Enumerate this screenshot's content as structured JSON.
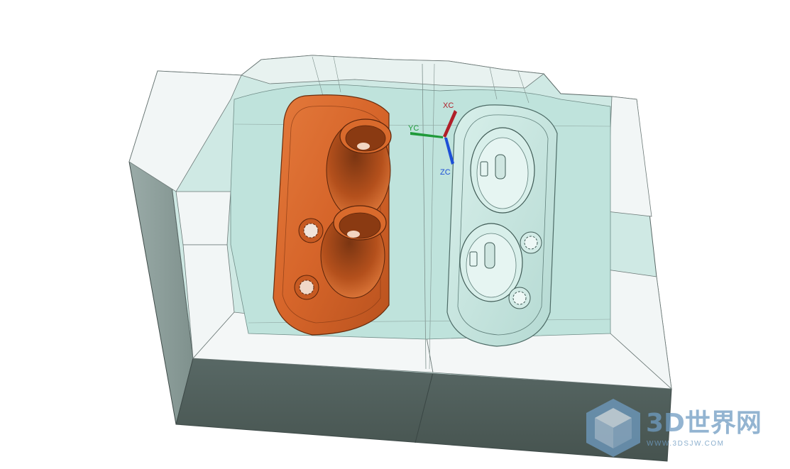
{
  "viewport": {
    "background": "#ffffff",
    "colors": {
      "mold_body": "#cfe9e4",
      "mold_top": "#f4f7f7",
      "mold_front": "#4e5d5a",
      "mold_side": "#8e9f9c",
      "cavity_floor": "#bfe3dc",
      "part_left": "#d6652a",
      "part_right": "#c7e7e1"
    }
  },
  "axes": {
    "xc_label": "XC",
    "yc_label": "YC",
    "zc_label": "ZC",
    "xc_color": "#b01e28",
    "yc_color": "#1f9a3a",
    "zc_color": "#1c4fd6"
  },
  "watermark": {
    "title": "3D世界网",
    "url": "WWW.3DSJW.COM",
    "color": "#6f9cc2"
  }
}
